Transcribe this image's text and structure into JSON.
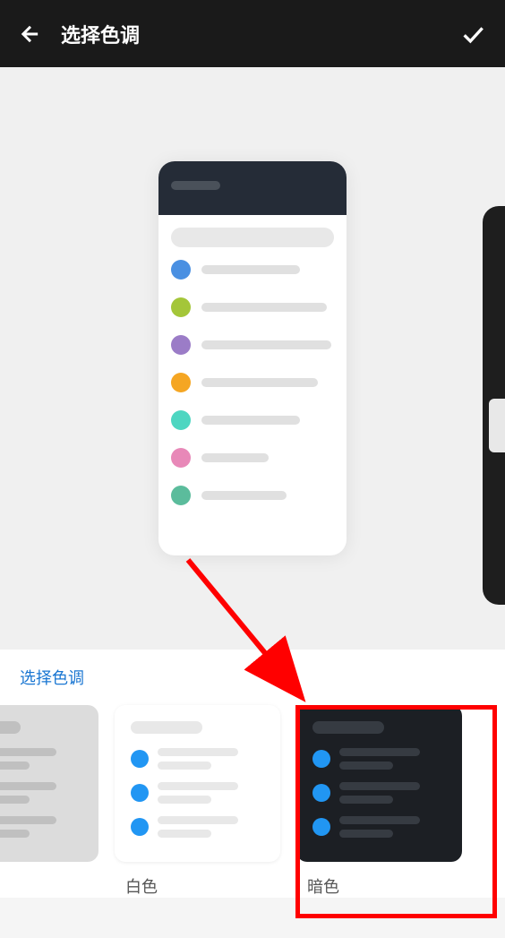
{
  "header": {
    "title": "选择色调"
  },
  "preview": {
    "dotColors": [
      "#4a90e2",
      "#a4c639",
      "#9b7cc7",
      "#f5a623",
      "#4dd6c1",
      "#e888b8",
      "#5bbc9c"
    ]
  },
  "section": {
    "label": "选择色调"
  },
  "themes": [
    {
      "label": "",
      "variant": "gray"
    },
    {
      "label": "白色",
      "variant": "white"
    },
    {
      "label": "暗色",
      "variant": "dark"
    }
  ],
  "colors": {
    "accentBlue": "#2196f3",
    "annotationRed": "#ff0000"
  }
}
